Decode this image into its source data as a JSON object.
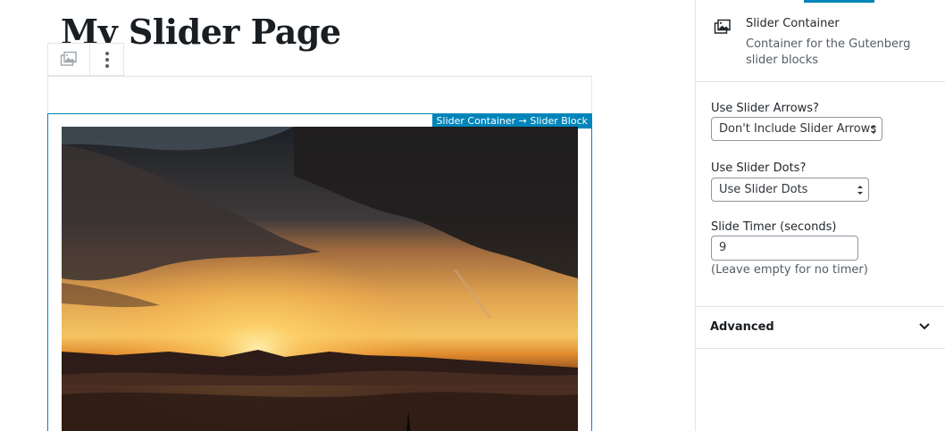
{
  "editor": {
    "post_title": "My Slider Page",
    "toolbar": {
      "block_type_icon": "gallery-icon",
      "more_options_icon": "vertical-ellipsis-icon"
    },
    "breadcrumb": "Slider Container → Slider Block"
  },
  "sidebar": {
    "block_card": {
      "icon": "gallery-icon",
      "title": "Slider Container",
      "description": "Container for the Gutenberg slider blocks"
    },
    "settings": {
      "arrows_label": "Use Slider Arrows?",
      "arrows_value": "Don't Include Slider Arrows",
      "dots_label": "Use Slider Dots?",
      "dots_value": "Use Slider Dots",
      "timer_label": "Slide Timer (seconds)",
      "timer_value": "9",
      "timer_help": "(Leave empty for no timer)"
    },
    "advanced": {
      "label": "Advanced",
      "icon": "chevron-down-icon"
    }
  },
  "colors": {
    "accent": "#0085ba",
    "border": "#e2e4e7"
  }
}
